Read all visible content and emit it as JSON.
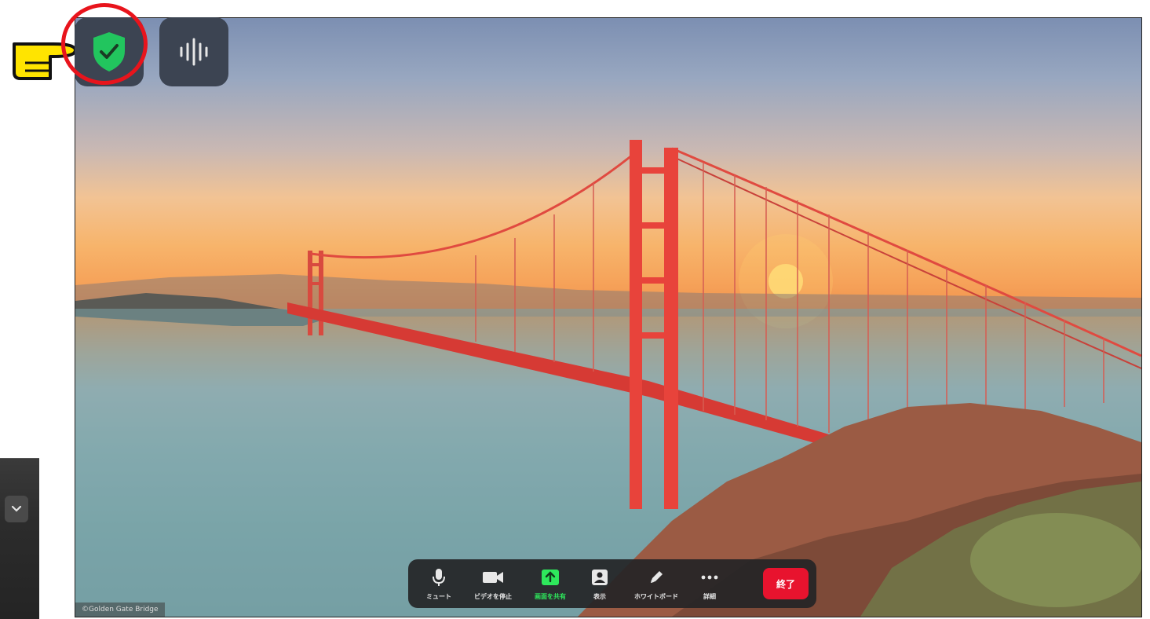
{
  "meeting": {
    "photo_credit": "©Golden Gate Bridge"
  },
  "status_icons": {
    "shield": "shield-check-icon",
    "audio": "audio-wave-icon"
  },
  "toolbar": {
    "items": [
      {
        "label": "ミュート",
        "icon": "microphone-icon"
      },
      {
        "label": "ビデオを停止",
        "icon": "video-camera-icon"
      },
      {
        "label": "画面を共有",
        "icon": "share-screen-icon"
      },
      {
        "label": "表示",
        "icon": "view-icon"
      },
      {
        "label": "ホワイトボード",
        "icon": "pencil-icon"
      },
      {
        "label": "詳細",
        "icon": "more-icon"
      }
    ],
    "end_label": "終了"
  },
  "colors": {
    "highlight_circle": "#e8141c",
    "shield_green": "#22c55e",
    "share_green": "#2ee85c",
    "end_red": "#e8132e"
  }
}
